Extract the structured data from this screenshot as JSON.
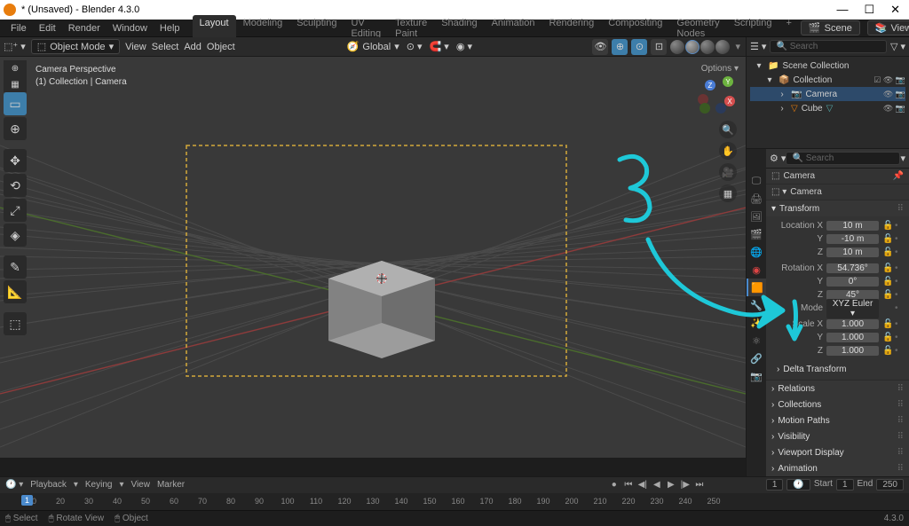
{
  "title": "* (Unsaved) - Blender 4.3.0",
  "version": "4.3.0",
  "topmenu": {
    "items": [
      "File",
      "Edit",
      "Render",
      "Window",
      "Help"
    ]
  },
  "workspaces": [
    "Layout",
    "Modeling",
    "Sculpting",
    "UV Editing",
    "Texture Paint",
    "Shading",
    "Animation",
    "Rendering",
    "Compositing",
    "Geometry Nodes",
    "Scripting"
  ],
  "active_workspace": 0,
  "scene": "Scene",
  "viewlayer": "ViewLayer",
  "viewport": {
    "mode": "Object Mode",
    "menus": [
      "View",
      "Select",
      "Add",
      "Object"
    ],
    "orientation": "Global",
    "info1": "Camera Perspective",
    "info2": "(1) Collection | Camera",
    "options": "Options"
  },
  "outliner": {
    "search_placeholder": "Search",
    "root": "Scene Collection",
    "collection": "Collection",
    "items": [
      {
        "name": "Camera",
        "selected": true
      },
      {
        "name": "Cube",
        "selected": false
      }
    ]
  },
  "properties": {
    "search_placeholder": "Search",
    "breadcrumb1": "Camera",
    "breadcrumb2": "Camera",
    "panels": {
      "transform": {
        "title": "Transform",
        "location": {
          "x": "10 m",
          "y": "-10 m",
          "z": "10 m"
        },
        "rotation": {
          "x": "54.736°",
          "y": "0°",
          "z": "45°"
        },
        "mode": "XYZ Euler",
        "scale": {
          "x": "1.000",
          "y": "1.000",
          "z": "1.000"
        },
        "delta": "Delta Transform"
      },
      "collapsed": [
        "Relations",
        "Collections",
        "Motion Paths",
        "Visibility",
        "Viewport Display",
        "Animation"
      ]
    }
  },
  "timeline": {
    "menus": [
      "Playback",
      "Keying",
      "View",
      "Marker"
    ],
    "current": "1",
    "start_label": "Start",
    "start": "1",
    "end_label": "End",
    "end": "250",
    "ticks": [
      "1",
      "10",
      "20",
      "30",
      "40",
      "50",
      "60",
      "70",
      "80",
      "90",
      "100",
      "110",
      "120",
      "130",
      "140",
      "150",
      "160",
      "170",
      "180",
      "190",
      "200",
      "210",
      "220",
      "230",
      "240",
      "250"
    ]
  },
  "status": {
    "select": "Select",
    "rotate": "Rotate View",
    "object": "Object"
  },
  "annotation_text": "3"
}
